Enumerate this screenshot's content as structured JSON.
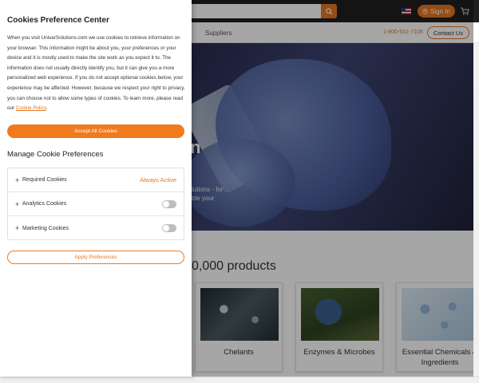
{
  "site": {
    "header": {
      "sign_in_label": "Sign In"
    },
    "nav": {
      "suppliers_label": "Suppliers",
      "phone": "1-800-531-7106",
      "contact_label": "Contact Us"
    },
    "hero": {
      "heading_fragment": "n",
      "subtext_line1": "lutions - for",
      "subtext_line2": "ble your"
    },
    "products_title": "0,000 products",
    "product_cards": [
      {
        "label": "Chelants"
      },
      {
        "label": "Enzymes & Microbes"
      },
      {
        "label": "Essential Chemicals & Ingredients"
      }
    ]
  },
  "cookie_panel": {
    "title": "Cookies Preference Center",
    "description": "When you visit UnivarSolutions.com we use cookies to retrieve information on your browser. This information might be about you, your preferences or your device and it is mostly used to make the site work as you expect it to. The information does not usually directly identify you, but it can give you a more personalized web experience. If you do not accept optional cookies below, your experience may be affected. However, because we respect your right to privacy, you can choose not to allow some types of cookies. To learn more, please read our",
    "policy_link": "Cookie Policy",
    "policy_suffix": ".",
    "accept_all_label": "Accept All Cookies",
    "manage_title": "Manage Cookie Preferences",
    "preferences": [
      {
        "label": "Required Cookies",
        "status": "Always Active"
      },
      {
        "label": "Analytics Cookies",
        "enabled": false
      },
      {
        "label": "Marketing Cookies",
        "enabled": false
      }
    ],
    "apply_label": "Apply Preferences"
  },
  "colors": {
    "accent": "#f07a1e",
    "topbar": "#1f1f1f"
  }
}
